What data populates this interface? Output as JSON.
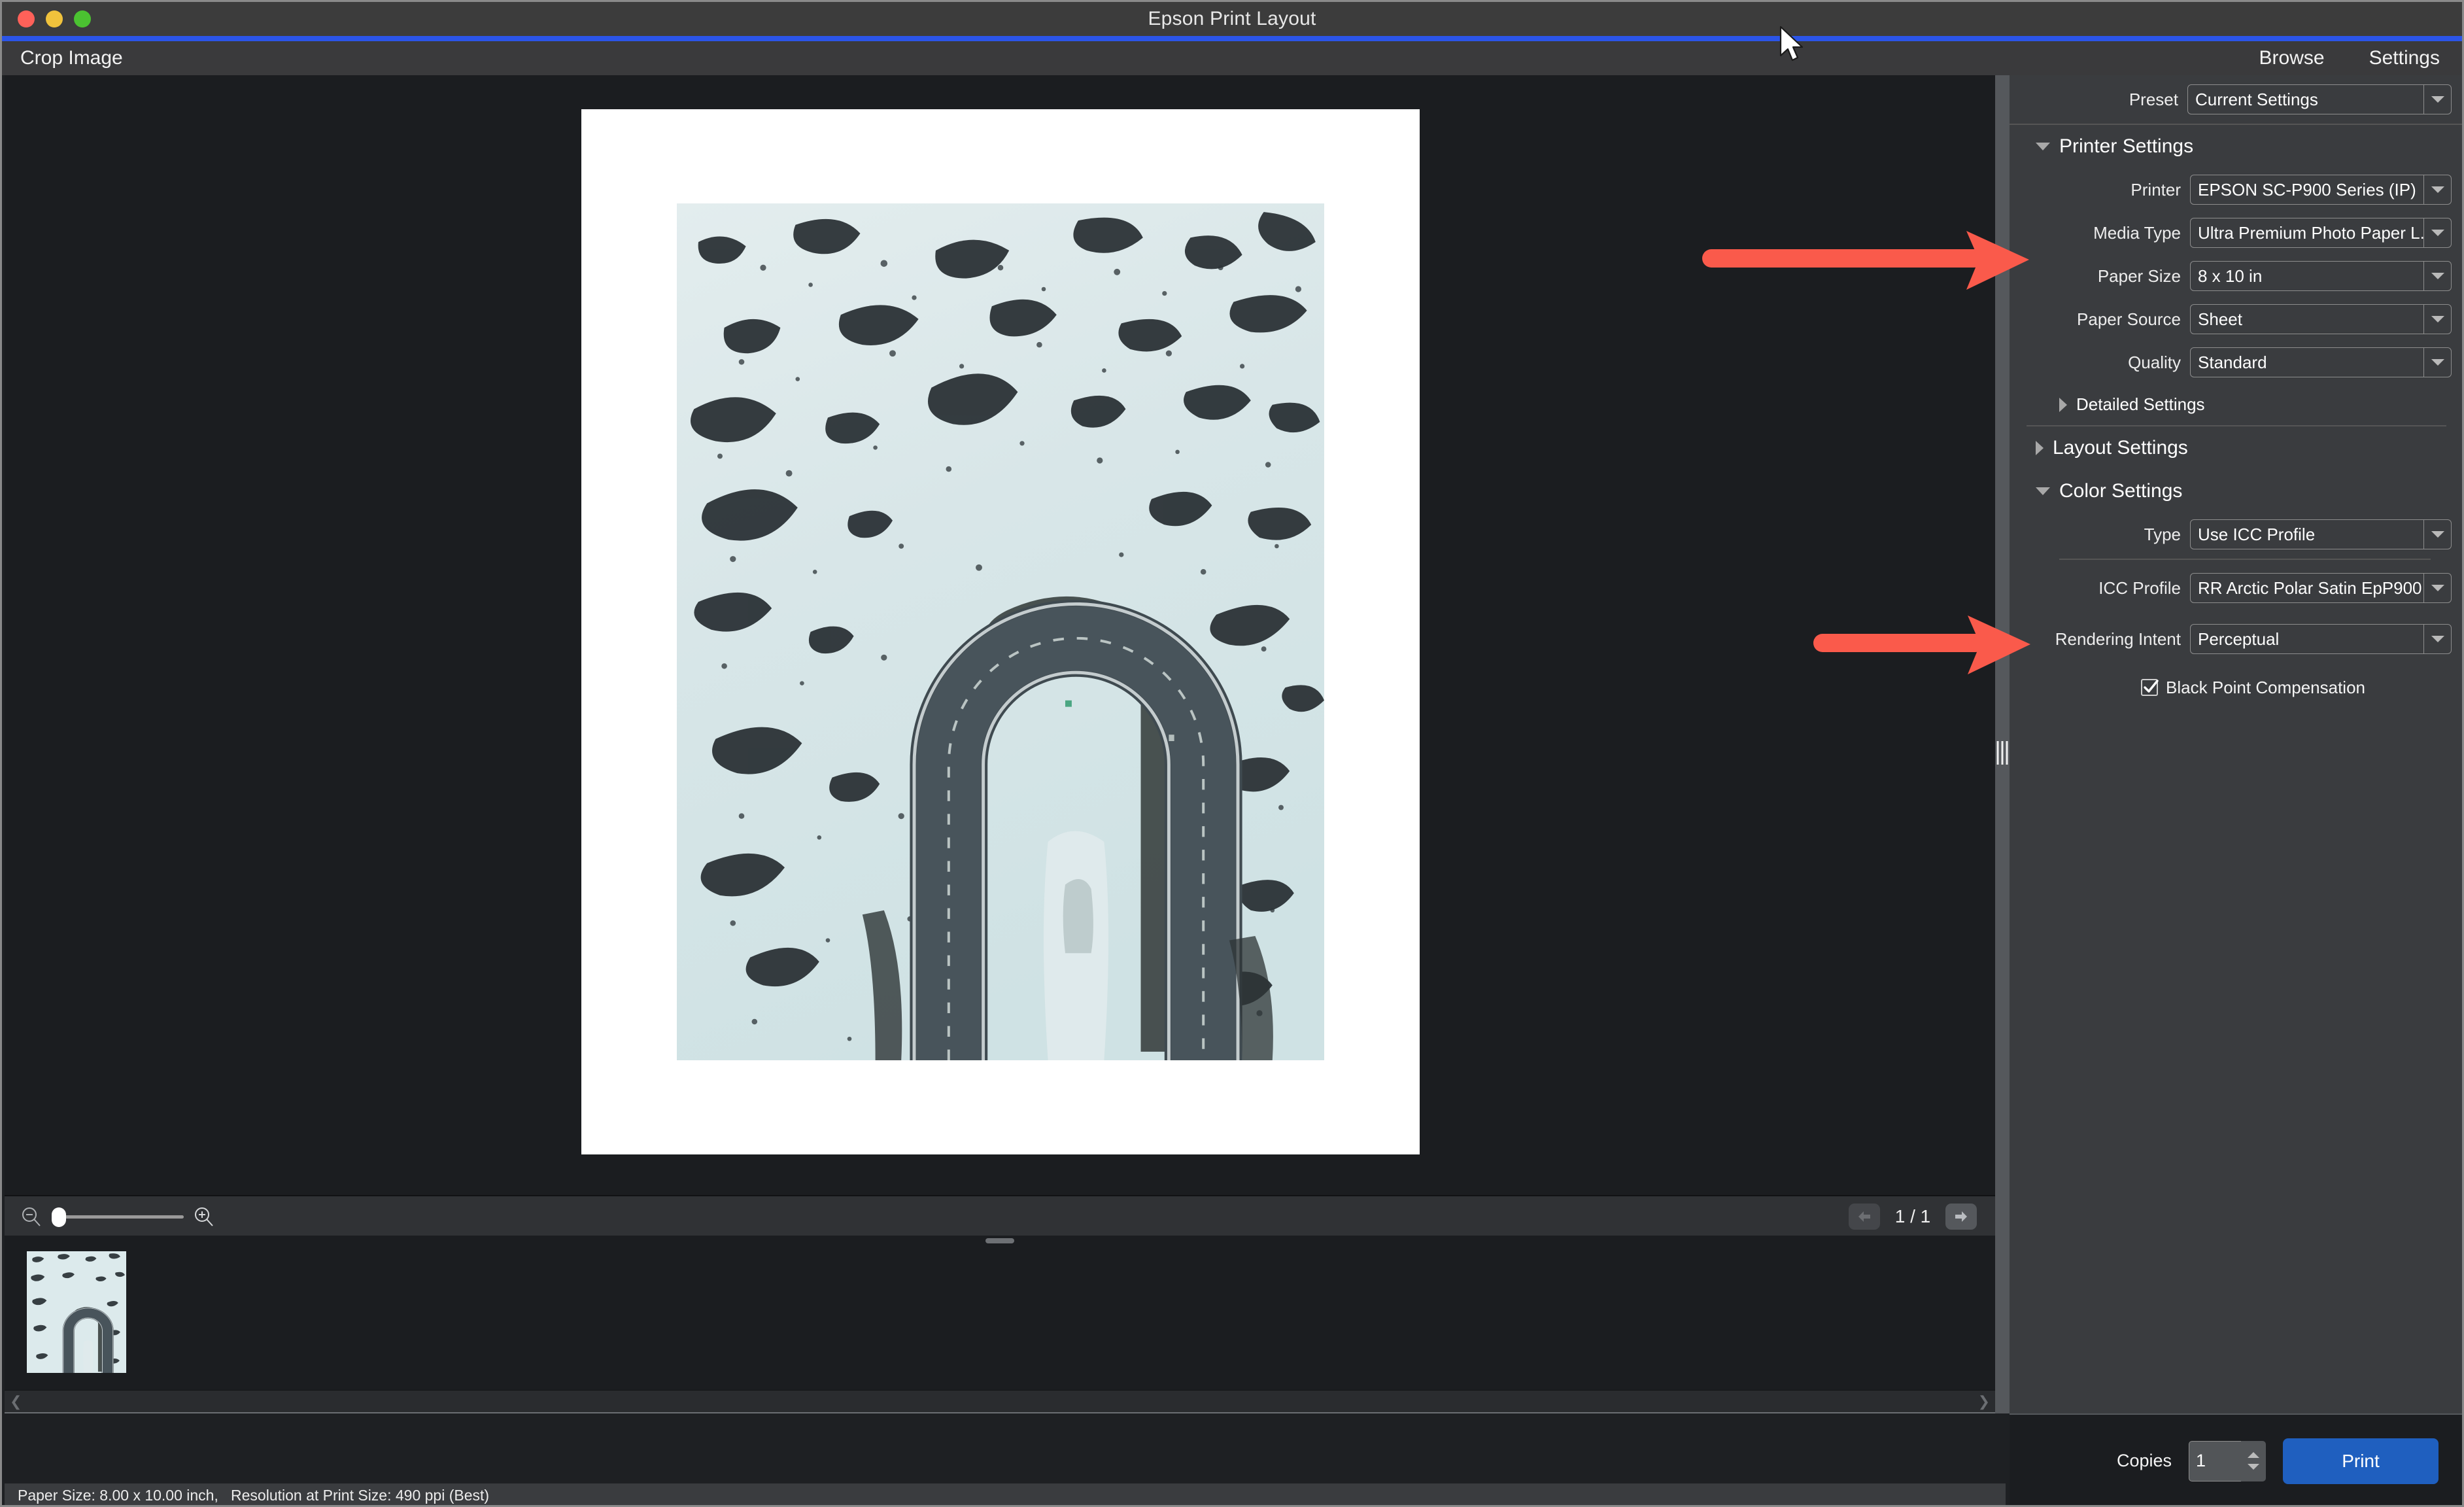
{
  "window": {
    "title": "Epson Print Layout",
    "traffic_lights": [
      "close",
      "minimize",
      "zoom"
    ]
  },
  "toolbar": {
    "crop_label": "Crop Image",
    "browse_label": "Browse",
    "settings_label": "Settings"
  },
  "preview": {
    "page_indicator": "1 / 1",
    "zoom_minus_icon": "zoom-out-icon",
    "zoom_plus_icon": "zoom-in-icon",
    "prev_icon": "arrow-left-icon",
    "next_icon": "arrow-right-icon"
  },
  "panel": {
    "preset": {
      "label": "Preset",
      "value": "Current Settings"
    },
    "printer_settings": {
      "title": "Printer Settings",
      "expanded": true,
      "fields": [
        {
          "label": "Printer",
          "value": "EPSON SC-P900 Series (IP)"
        },
        {
          "label": "Media Type",
          "value": "Ultra Premium Photo Paper L..."
        },
        {
          "label": "Paper Size",
          "value": "8 x 10 in"
        },
        {
          "label": "Paper Source",
          "value": "Sheet"
        },
        {
          "label": "Quality",
          "value": "Standard"
        }
      ],
      "detailed_settings": {
        "title": "Detailed Settings",
        "expanded": false
      }
    },
    "layout_settings": {
      "title": "Layout Settings",
      "expanded": false
    },
    "color_settings": {
      "title": "Color Settings",
      "expanded": true,
      "type": {
        "label": "Type",
        "value": "Use ICC Profile"
      },
      "icc_profile": {
        "label": "ICC Profile",
        "value": "RR Arctic Polar Satin EpP900"
      },
      "rendering_intent": {
        "label": "Rendering Intent",
        "value": "Perceptual"
      },
      "black_point": {
        "label": "Black Point Compensation",
        "checked": true
      }
    }
  },
  "footer": {
    "copies_label": "Copies",
    "copies_value": "1",
    "print_label": "Print"
  },
  "status": {
    "text": "Paper Size: 8.00 x 10.00 inch,   Resolution at Print Size: 490 ppi (Best)"
  },
  "annotations": {
    "arrow_color": "#fa5a4b",
    "arrows": [
      {
        "name": "media-type-arrow",
        "points_to": "Media Type"
      },
      {
        "name": "rendering-intent-arrow",
        "points_to": "Rendering Intent"
      }
    ]
  },
  "colors": {
    "accent_blue": "#2b55e8",
    "print_button": "#1f5fbf",
    "panel_bg": "#3a3c3f",
    "canvas_bg": "#1b1d20"
  }
}
